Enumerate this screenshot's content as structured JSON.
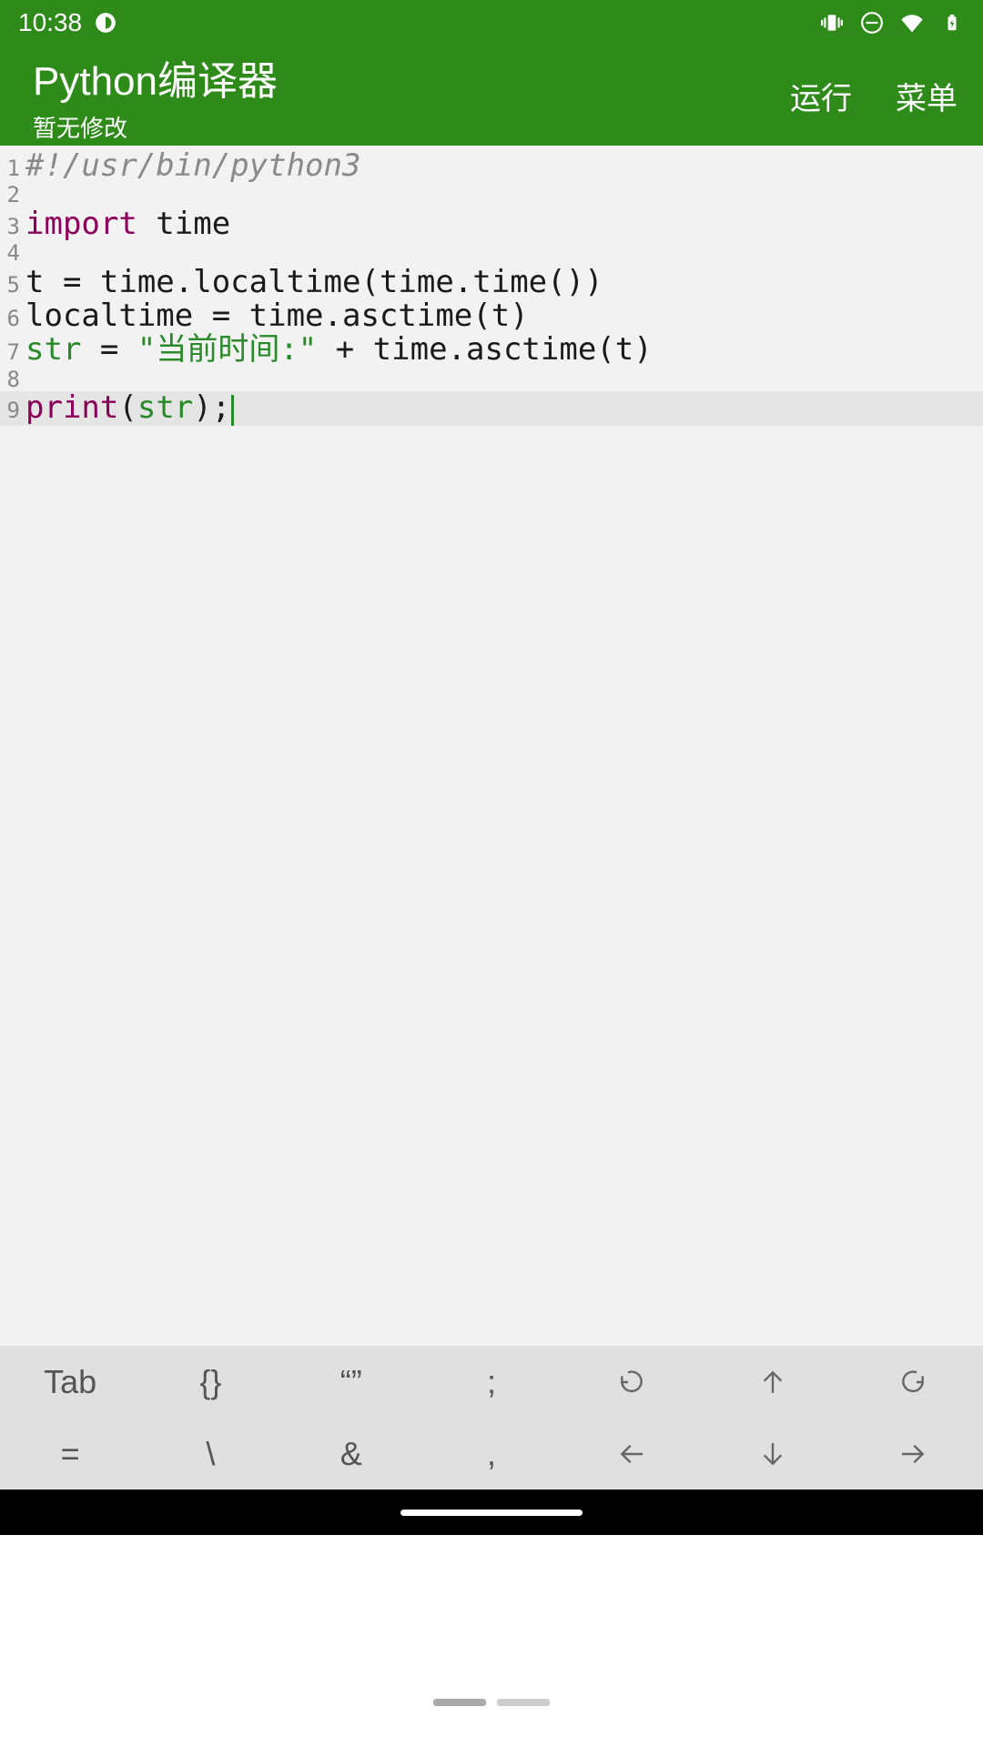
{
  "status": {
    "time": "10:38"
  },
  "header": {
    "title": "Python编译器",
    "subtitle": "暂无修改",
    "run_label": "运行",
    "menu_label": "菜单"
  },
  "code": {
    "lines": [
      {
        "num": "1",
        "tokens": [
          {
            "t": "comment",
            "v": "#!/usr/bin/python3"
          }
        ]
      },
      {
        "num": "2",
        "tokens": []
      },
      {
        "num": "3",
        "tokens": [
          {
            "t": "keyword",
            "v": "import"
          },
          {
            "t": "plain",
            "v": " time"
          }
        ]
      },
      {
        "num": "4",
        "tokens": []
      },
      {
        "num": "5",
        "tokens": [
          {
            "t": "plain",
            "v": "t = time.localtime(time.time())"
          }
        ]
      },
      {
        "num": "6",
        "tokens": [
          {
            "t": "plain",
            "v": "localtime = time.asctime(t)"
          }
        ]
      },
      {
        "num": "7",
        "tokens": [
          {
            "t": "builtin",
            "v": "str"
          },
          {
            "t": "plain",
            "v": " = "
          },
          {
            "t": "string",
            "v": "\"当前时间:\""
          },
          {
            "t": "plain",
            "v": " + time.asctime(t)"
          }
        ]
      },
      {
        "num": "8",
        "tokens": []
      },
      {
        "num": "9",
        "current": true,
        "cursor": true,
        "tokens": [
          {
            "t": "func",
            "v": "print"
          },
          {
            "t": "plain",
            "v": "("
          },
          {
            "t": "builtin",
            "v": "str"
          },
          {
            "t": "plain",
            "v": ");"
          }
        ]
      }
    ]
  },
  "keyboard": {
    "row1": [
      "Tab",
      "{}",
      "“”",
      ";",
      "undo-icon",
      "arrow-up-icon",
      "redo-icon"
    ],
    "row2": [
      "=",
      "\\",
      "&",
      ",",
      "arrow-left-icon",
      "arrow-down-icon",
      "arrow-right-icon"
    ]
  }
}
